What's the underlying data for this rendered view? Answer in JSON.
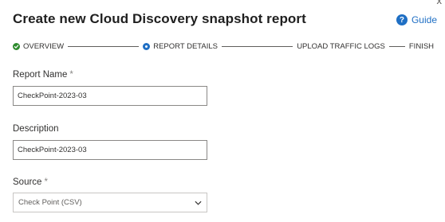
{
  "dialog": {
    "title": "Create new Cloud Discovery snapshot report",
    "guide_label": "Guide",
    "guide_icon": "?",
    "close_glyph": "x"
  },
  "wizard": {
    "steps": [
      {
        "label": "OVERVIEW",
        "state": "completed"
      },
      {
        "label": "REPORT DETAILS",
        "state": "current"
      },
      {
        "label": "UPLOAD TRAFFIC LOGS",
        "state": "pending"
      },
      {
        "label": "FINISH",
        "state": "pending"
      }
    ]
  },
  "form": {
    "report_name": {
      "label": "Report Name",
      "required_mark": "*",
      "value": "CheckPoint-2023-03"
    },
    "description": {
      "label": "Description",
      "value": "CheckPoint-2023-03"
    },
    "source": {
      "label": "Source",
      "required_mark": "*",
      "selected": "Check Point (CSV)"
    }
  },
  "colors": {
    "accent": "#1f6fc4",
    "success": "#2e8b2e",
    "border": "#8a8886"
  }
}
